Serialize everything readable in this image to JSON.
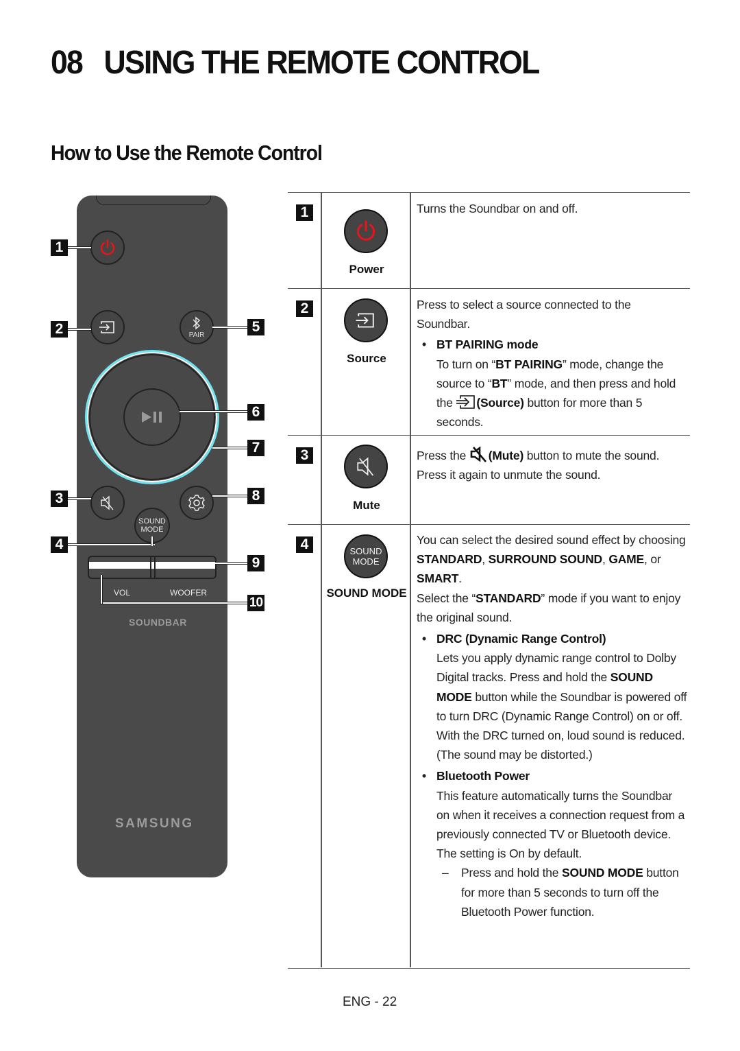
{
  "chapter": {
    "number": "08",
    "title": "USING THE REMOTE CONTROL"
  },
  "section_title": "How to Use the Remote Control",
  "remote": {
    "callouts": [
      "1",
      "2",
      "3",
      "4",
      "5",
      "6",
      "7",
      "8",
      "9",
      "10"
    ],
    "pair_label": "PAIR",
    "sound_mode_label_line1": "SOUND",
    "sound_mode_label_line2": "MODE",
    "vol_label": "VOL",
    "woofer_label": "WOOFER",
    "soundbar_label": "SOUNDBAR",
    "brand": "SAMSUNG",
    "power_color": "#e8141b",
    "ring_color": "#6fe3f0"
  },
  "table": {
    "rows": [
      {
        "num": "1",
        "name": "Power",
        "icon": "power-icon",
        "desc": "Turns the Soundbar on and off."
      },
      {
        "num": "2",
        "name": "Source",
        "icon": "source-icon",
        "desc_line": "Press to select a source connected to the Soundbar.",
        "bullet_title": "BT PAIRING mode",
        "bullet_text_1": "To turn on “",
        "bullet_bold_1": "BT PAIRING",
        "bullet_text_2": "” mode, change the source to “",
        "bullet_bold_2": "BT",
        "bullet_text_3": "” mode, and then press and hold the ",
        "bullet_bold_3": "(Source)",
        "bullet_text_4": " button for more than 5 seconds."
      },
      {
        "num": "3",
        "name": "Mute",
        "icon": "mute-icon",
        "text_1": "Press the ",
        "bold_1": "(Mute)",
        "text_2": " button to mute the sound. Press it again to unmute the sound."
      },
      {
        "num": "4",
        "name": "SOUND MODE",
        "icon": "sound-mode-icon",
        "icon_line1": "SOUND",
        "icon_line2": "MODE",
        "p1_text_1": "You can select the desired sound effect by choosing ",
        "p1_bold_1": "STANDARD",
        "p1_text_2": ", ",
        "p1_bold_2": "SURROUND SOUND",
        "p1_text_3": ", ",
        "p1_bold_3": "GAME",
        "p1_text_4": ", or ",
        "p1_bold_4": "SMART",
        "p1_text_5": ".",
        "p2_text_1": "Select the “",
        "p2_bold_1": "STANDARD",
        "p2_text_2": "” mode if you want to enjoy the original sound.",
        "drc_title": "DRC (Dynamic Range Control)",
        "drc_text_1": "Lets you apply dynamic range control to Dolby Digital tracks. Press and hold the ",
        "drc_bold_1": "SOUND MODE",
        "drc_text_2": " button while the Soundbar is powered off to turn DRC (Dynamic Range Control) on or off. With the DRC turned on, loud sound is reduced. (The sound may be distorted.)",
        "bt_title": "Bluetooth Power",
        "bt_text": "This feature automatically turns the Soundbar on when it receives a connection request from a previously connected TV or Bluetooth device. The setting is On by default.",
        "dash_text_1": "Press and hold the ",
        "dash_bold_1": "SOUND MODE",
        "dash_text_2": " button for more than 5 seconds to turn off the Bluetooth Power function."
      }
    ]
  },
  "footer": {
    "page": "ENG - 22"
  }
}
